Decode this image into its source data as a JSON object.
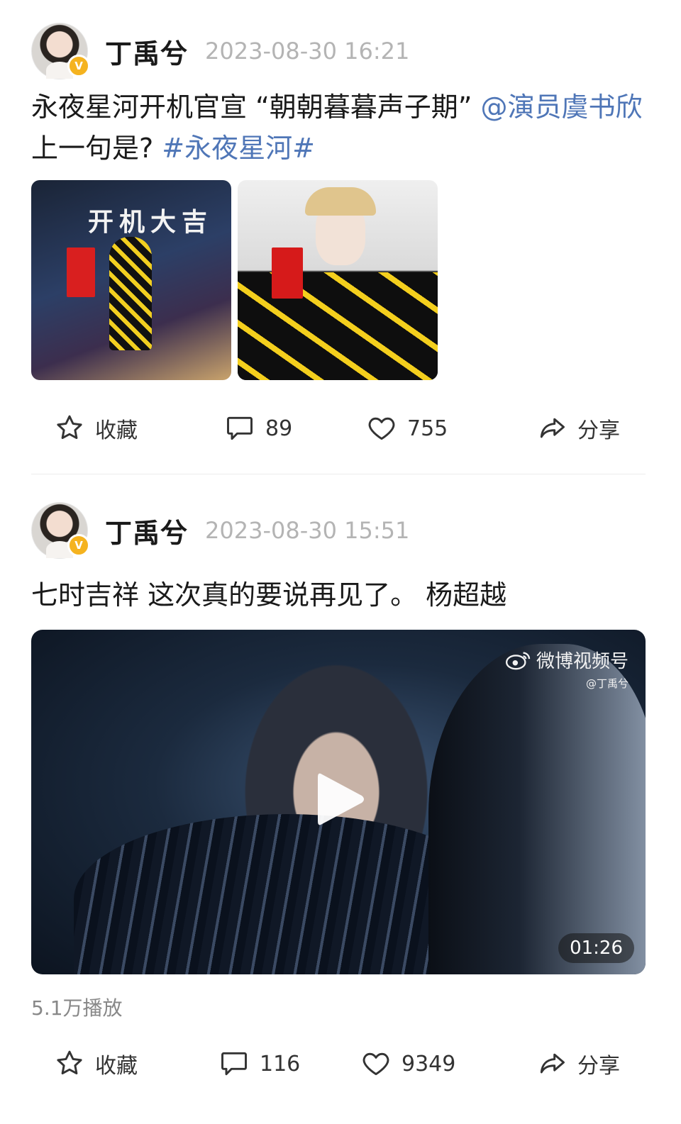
{
  "posts": [
    {
      "user": {
        "name": "丁禹兮"
      },
      "time": "2023-08-30 16:21",
      "text": {
        "plain1": "永夜星河开机官宣 “朝朝暮暮声子期” ",
        "mention": "@演员虞书欣",
        "plain2": " 上一句是? ",
        "hashtag": "#永夜星河#"
      },
      "images": [
        {
          "caption": "开机大吉"
        },
        {
          "caption": ""
        }
      ],
      "actions": {
        "favorite": "收藏",
        "comments": "89",
        "likes": "755",
        "share": "分享"
      }
    },
    {
      "user": {
        "name": "丁禹兮"
      },
      "time": "2023-08-30 15:51",
      "text": {
        "plain1": "七时吉祥 这次真的要说再见了。 杨超越"
      },
      "video": {
        "watermark_brand": "微博视频号",
        "watermark_handle": "@丁禹兮",
        "duration": "01:26"
      },
      "plays": "5.1万播放",
      "actions": {
        "favorite": "收藏",
        "comments": "116",
        "likes": "9349",
        "share": "分享"
      }
    }
  ],
  "colors": {
    "link": "#4f76b7",
    "time": "#b4b4b4",
    "verified": "#f5b31f"
  }
}
